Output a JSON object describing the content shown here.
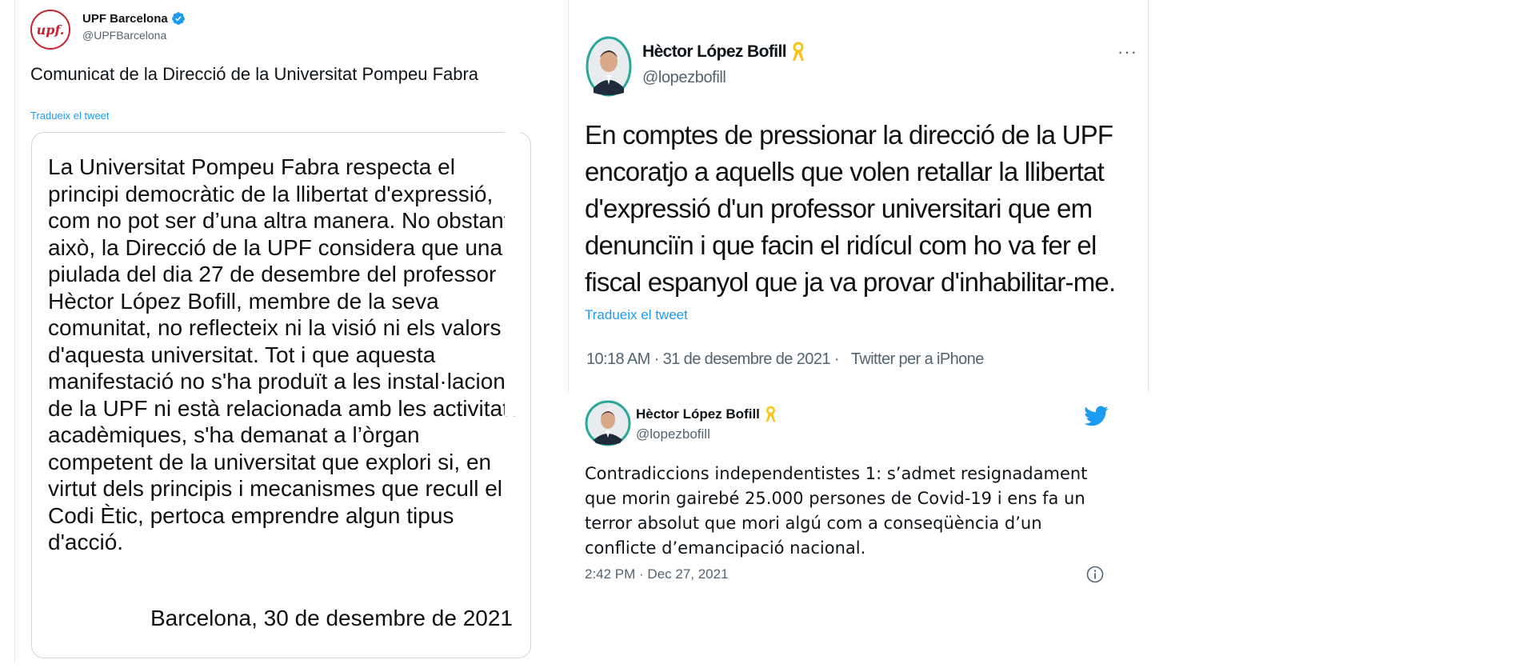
{
  "tweet_upf": {
    "avatar_text": "upf.",
    "author_name": "UPF Barcelona",
    "author_handle": "@UPFBarcelona",
    "text": "Comunicat de la Direcció de la Universitat Pompeu Fabra",
    "translate_label": "Tradueix el tweet",
    "statement_text": "La Universitat Pompeu Fabra respecta el principi democràtic de la llibertat d'expressió, com no pot ser d’una altra manera. No obstant això, la Direcció de la UPF considera que una piulada del dia 27 de desembre del professor Hèctor López Bofill, membre de la seva comunitat, no reflecteix ni la visió ni els valors d'aquesta universitat. Tot i que aquesta manifestació no s'ha produït a les instal·lacions de la UPF ni està relacionada amb les activitats acadèmiques, s'ha demanat a l’òrgan competent de la universitat que explori si, en virtut dels principis i mecanismes que recull el Codi Ètic, pertoca emprendre algun tipus d'acció.",
    "statement_signoff": "Barcelona, 30 de desembre de 2021",
    "accent_color": "#c8232c"
  },
  "tweet_hector_large": {
    "author_name": "Hèctor López Bofill",
    "author_handle": "@lopezbofill",
    "more_label": "···",
    "text": "En comptes de pressionar la direcció de la UPF encoratjo a aquells que volen retallar la llibertat d'expressió d'un professor universitari que em denunciïn i que facin el ridícul com ho va fer el fiscal espanyol que ja va provar d'inhabilitar-me.",
    "translate_label": "Tradueix el tweet",
    "timestamp": "10:18 AM · 31 de desembre de 2021 ·",
    "source": "Twitter per a iPhone"
  },
  "tweet_hector_small": {
    "author_name": "Hèctor López Bofill",
    "author_handle": "@lopezbofill",
    "text": "Contradiccions independentistes 1: s’admet resignadament que morin gairebé 25.000 persones de Covid-19 i ens fa un terror absolut que mori algú com a conseqüència d’un conflicte d’emancipació nacional.",
    "timestamp": "2:42 PM · Dec 27, 2021",
    "brand_color": "#1d9bf0"
  },
  "icons": {
    "verified": "verified-badge-icon",
    "ribbon": "yellow-ribbon-icon",
    "bird": "twitter-bird-icon",
    "info": "info-icon",
    "more": "more-options-icon"
  }
}
